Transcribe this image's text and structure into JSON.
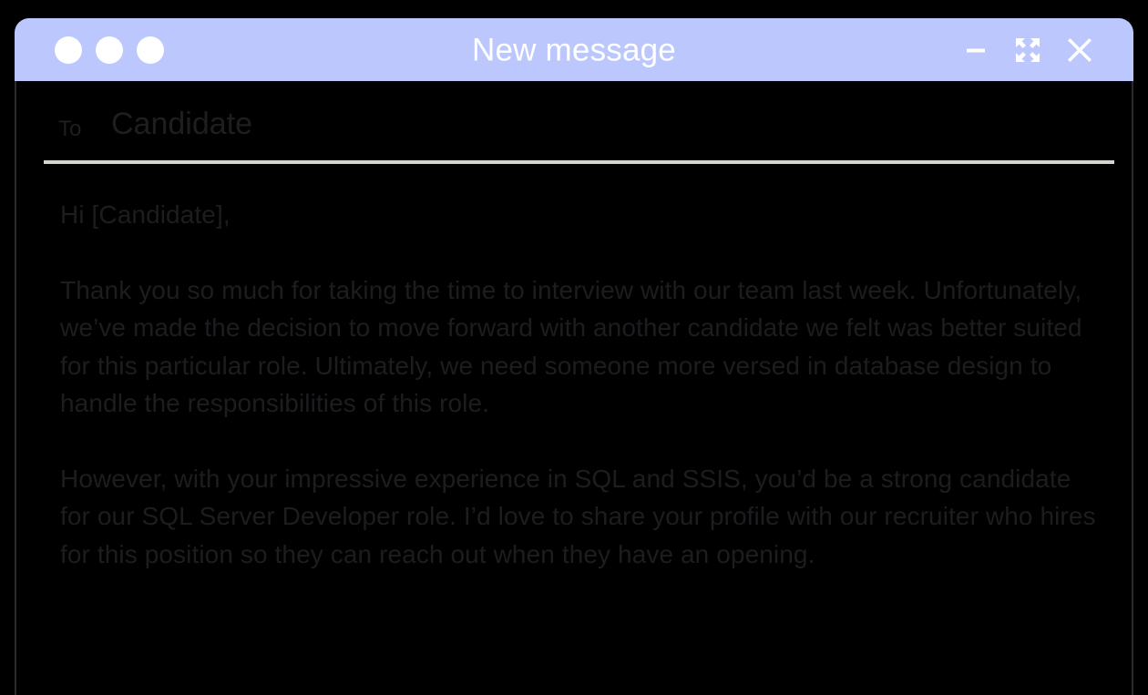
{
  "window": {
    "title": "New message",
    "title_bar_color": "#bbc7fd",
    "background_color": "#000000",
    "text_color": "#1d1d20",
    "traffic_lights": [
      {
        "name": "close-dot",
        "color": "#ffffff"
      },
      {
        "name": "minimize-dot",
        "color": "#ffffff"
      },
      {
        "name": "zoom-dot",
        "color": "#ffffff"
      }
    ],
    "controls": [
      {
        "name": "minimize-icon",
        "label": "Minimize"
      },
      {
        "name": "fullscreen-expand-icon",
        "label": "Maximize"
      },
      {
        "name": "close-icon",
        "label": "Close"
      }
    ]
  },
  "recipient": {
    "label": "To",
    "value": "Candidate",
    "divider_color": "#d5d4d0"
  },
  "body": {
    "paragraphs": [
      "Hi [Candidate],",
      "Thank you so much for taking the time to interview with our team last week. Unfortunately, we’ve made the decision to move forward with another candidate we felt was better suited for this particular role. Ultimately, we need someone more versed in database design to handle the responsibilities of this role.",
      "However, with your impressive experience in SQL and SSIS, you’d be a strong candidate for our SQL Server Developer role. I’d love to share your profile with our recruiter who hires for this position so they can reach out when they have an opening."
    ]
  }
}
